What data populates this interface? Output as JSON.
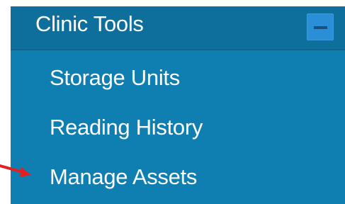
{
  "section": {
    "title": "Clinic Tools",
    "collapse_icon": "minus-icon"
  },
  "menu": {
    "items": [
      {
        "label": "Storage Units"
      },
      {
        "label": "Reading History"
      },
      {
        "label": "Manage Assets"
      }
    ]
  },
  "annotation": {
    "icon": "red-arrow-icon",
    "color": "#e32020"
  },
  "colors": {
    "panel_bg": "#0f7eb1",
    "header_bg": "#0e6f9d",
    "button_bg": "#2a8fd6",
    "text": "#ffffff"
  }
}
